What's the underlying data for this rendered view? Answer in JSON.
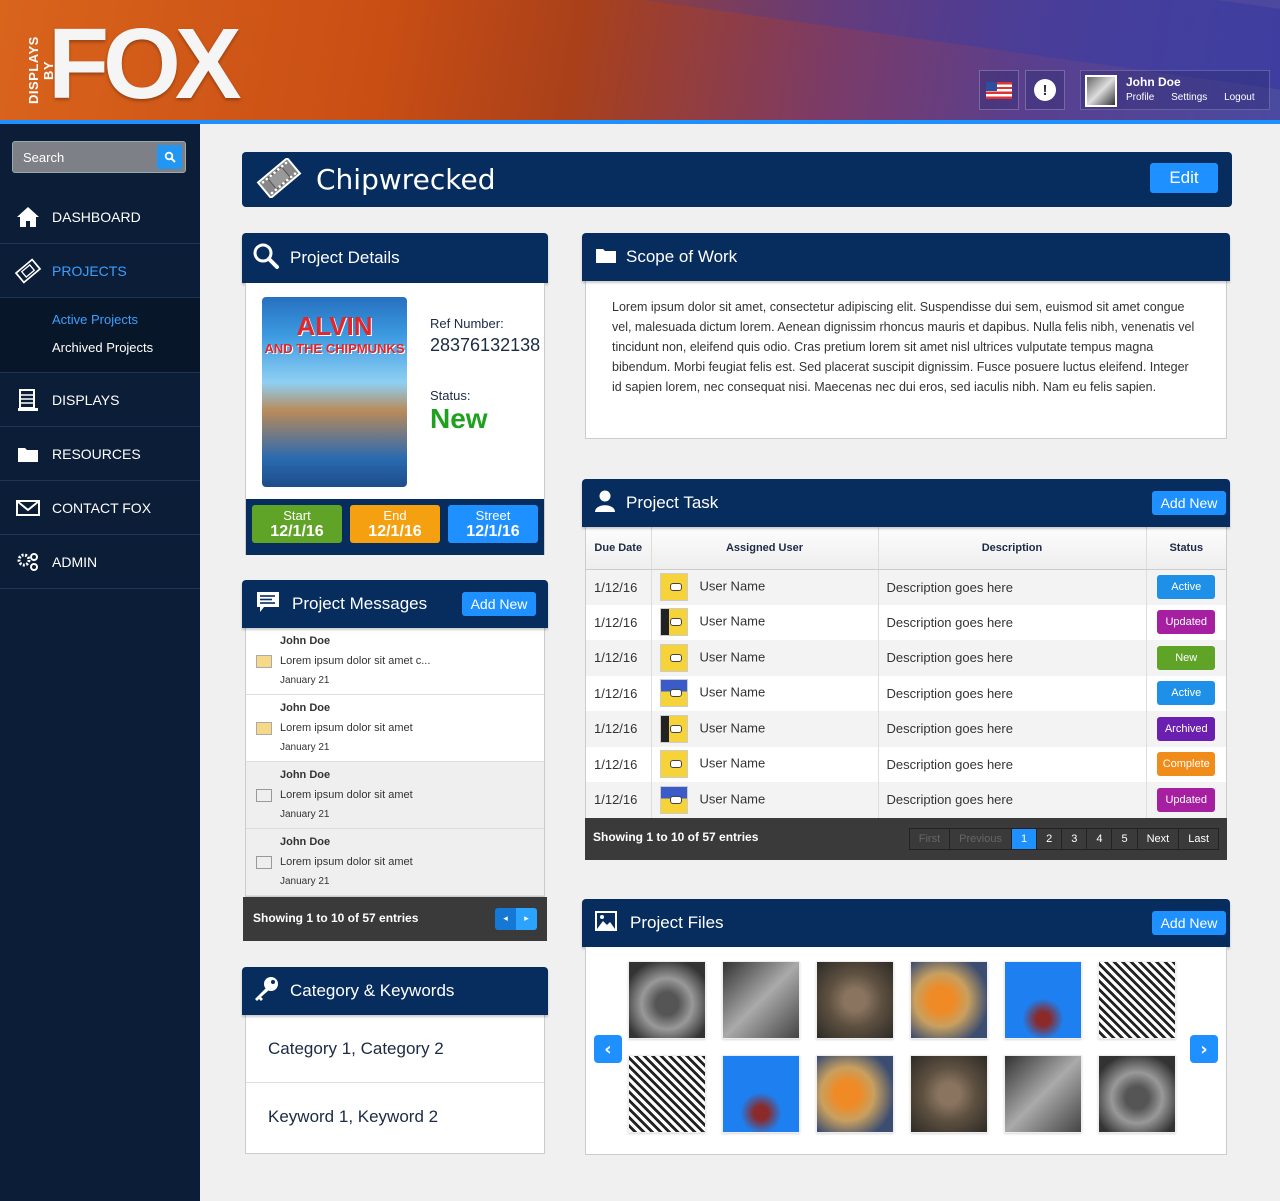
{
  "header": {
    "logo_prefix": "DISPLAYS BY",
    "logo_main": "FOX",
    "user": {
      "name": "John Doe",
      "links": [
        "Profile",
        "Settings",
        "Logout"
      ]
    },
    "alert_glyph": "!"
  },
  "sidebar": {
    "search_placeholder": "Search",
    "items": [
      {
        "label": "DASHBOARD",
        "icon": "home-icon"
      },
      {
        "label": "PROJECTS",
        "icon": "film-icon",
        "active": true
      },
      {
        "label": "DISPLAYS",
        "icon": "displays-icon"
      },
      {
        "label": "RESOURCES",
        "icon": "folder-icon"
      },
      {
        "label": "CONTACT FOX",
        "icon": "envelope-icon"
      },
      {
        "label": "ADMIN",
        "icon": "gears-icon"
      }
    ],
    "sub_items": [
      {
        "label": "Active Projects",
        "active": true
      },
      {
        "label": "Archived Projects"
      }
    ]
  },
  "title_bar": {
    "title": "Chipwrecked",
    "edit_label": "Edit"
  },
  "project_details": {
    "title": "Project Details",
    "poster_title": "ALVIN",
    "poster_subtitle": "AND THE CHIPMUNKS",
    "ref_label": "Ref Number:",
    "ref_value": "28376132138",
    "status_label": "Status:",
    "status_value": "New",
    "dates": [
      {
        "label": "Start",
        "value": "12/1/16",
        "color": "#5fa327"
      },
      {
        "label": "End",
        "value": "12/1/16",
        "color": "#f5a011"
      },
      {
        "label": "Street",
        "value": "12/1/16",
        "color": "#1e90ff"
      }
    ]
  },
  "messages": {
    "title": "Project Messages",
    "add_label": "Add New",
    "items": [
      {
        "author": "John Doe",
        "text": "Lorem ipsum dolor sit amet c...",
        "date": "January 21",
        "unread": true
      },
      {
        "author": "John Doe",
        "text": "Lorem ipsum dolor sit amet",
        "date": "January 21",
        "unread": true
      },
      {
        "author": "John Doe",
        "text": "Lorem ipsum dolor sit amet",
        "date": "January 21",
        "unread": false
      },
      {
        "author": "John Doe",
        "text": "Lorem ipsum dolor sit amet",
        "date": "January 21",
        "unread": false
      }
    ],
    "footer": "Showing 1 to 10 of 57 entries",
    "prev_glyph": "◂",
    "next_glyph": "▸"
  },
  "category_keywords": {
    "title": "Category & Keywords",
    "categories": "Category 1, Category 2",
    "keywords": "Keyword 1, Keyword 2"
  },
  "scope": {
    "title": "Scope of Work",
    "text": "Lorem ipsum dolor sit amet, consectetur adipiscing elit. Suspendisse dui sem, euismod sit amet congue vel, malesuada dictum lorem. Aenean dignissim rhoncus mauris et dapibus. Nulla felis nibh, venenatis vel tincidunt non, eleifend quis odio. Cras pretium lorem sit amet nisl ultrices vulputate tempus magna bibendum. Morbi feugiat felis est. Sed placerat suscipit dignissim. Fusce posuere luctus eleifend. Integer id sapien lorem, nec consequat nisi. Maecenas nec dui eros, sed iaculis nibh. Nam eu felis sapien."
  },
  "tasks": {
    "title": "Project Task",
    "add_label": "Add New",
    "columns": [
      "Due Date",
      "Assigned User",
      "Description",
      "Status"
    ],
    "rows": [
      {
        "due": "1/12/16",
        "user": "User Name",
        "avatar": "yellow",
        "desc": "Description goes here",
        "status": "Active",
        "color": "#1e90e8"
      },
      {
        "due": "1/12/16",
        "user": "User Name",
        "avatar": "dark",
        "desc": "Description goes here",
        "status": "Updated",
        "color": "#a51fa0"
      },
      {
        "due": "1/12/16",
        "user": "User Name",
        "avatar": "yellow",
        "desc": "Description goes here",
        "status": "New",
        "color": "#5fa327"
      },
      {
        "due": "1/12/16",
        "user": "User Name",
        "avatar": "blue",
        "desc": "Description goes here",
        "status": "Active",
        "color": "#1e90e8"
      },
      {
        "due": "1/12/16",
        "user": "User Name",
        "avatar": "dark",
        "desc": "Description goes here",
        "status": "Archived",
        "color": "#6a1fb0"
      },
      {
        "due": "1/12/16",
        "user": "User Name",
        "avatar": "yellow",
        "desc": "Description goes here",
        "status": "Complete",
        "color": "#f08c1a"
      },
      {
        "due": "1/12/16",
        "user": "User Name",
        "avatar": "blue",
        "desc": "Description goes here",
        "status": "Updated",
        "color": "#a51fa0"
      }
    ],
    "footer": "Showing 1 to 10 of 57 entries",
    "pages": [
      "First",
      "Previous",
      "1",
      "2",
      "3",
      "4",
      "5",
      "Next",
      "Last"
    ],
    "current_page": "1"
  },
  "files": {
    "title": "Project Files",
    "add_label": "Add New",
    "prev_glyph": "‹",
    "next_glyph": "›",
    "thumbnails": [
      "cat-bw",
      "bird-bw",
      "wallaby",
      "koi-fish",
      "jellyfish",
      "foliage-bw",
      "foliage-bw",
      "jellyfish",
      "koi-fish",
      "wallaby",
      "bird-bw",
      "cat-bw"
    ]
  }
}
